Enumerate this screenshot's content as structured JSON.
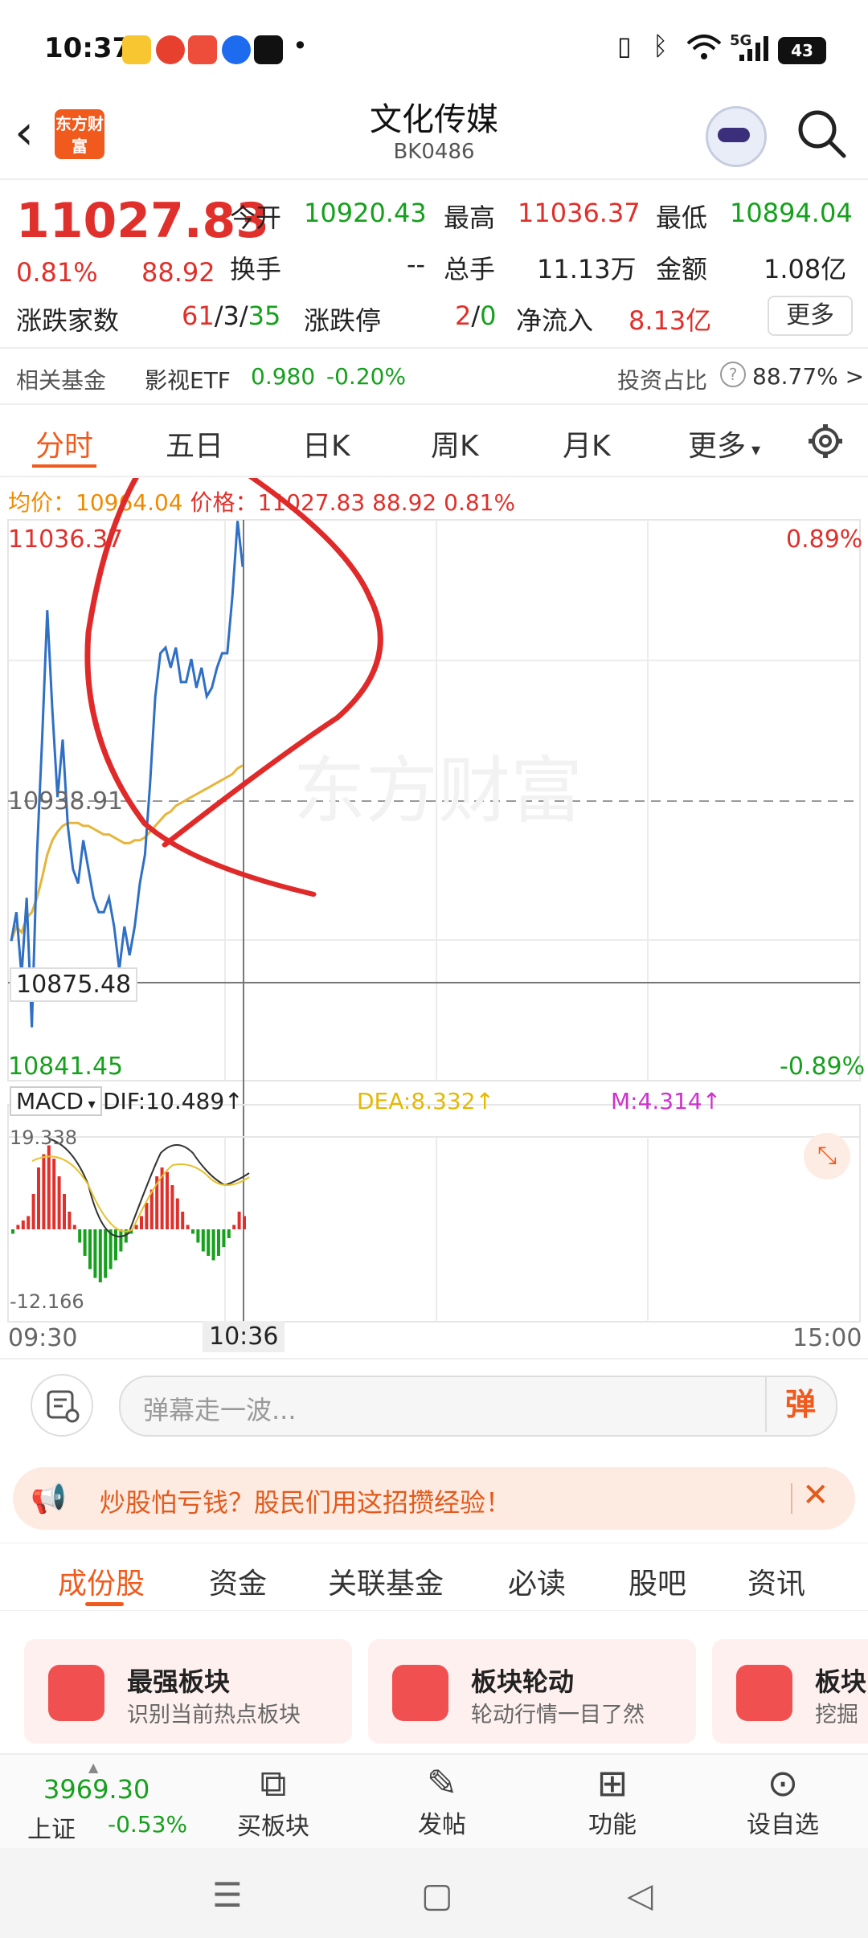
{
  "status": {
    "time": "10:37",
    "battery": "43",
    "network": "5G"
  },
  "header": {
    "title": "文化传媒",
    "code": "BK0486",
    "logo_text": "东方财富"
  },
  "quote": {
    "price": "11027.83",
    "change_pct": "0.81%",
    "change": "88.92",
    "open_label": "今开",
    "open": "10920.43",
    "high_label": "最高",
    "high": "11036.37",
    "low_label": "最低",
    "low": "10894.04",
    "turnover_label": "换手",
    "turnover": "--",
    "volume_label": "总手",
    "volume": "11.13万",
    "amount_label": "金额",
    "amount": "1.08亿",
    "updown_label": "涨跌家数",
    "up": "61",
    "flat": "3",
    "down": "35",
    "limit_label": "涨跌停",
    "limit_up": "2",
    "limit_down": "0",
    "inflow_label": "净流入",
    "inflow": "8.13亿",
    "more_label": "更多"
  },
  "fund": {
    "label": "相关基金",
    "name": "影视ETF",
    "price": "0.980",
    "pct": "-0.20%",
    "ratio_label": "投资占比",
    "ratio": "88.77% >"
  },
  "tabs": [
    "分时",
    "五日",
    "日K",
    "周K",
    "月K",
    "更多"
  ],
  "chart_header": {
    "avg_label": "均价：",
    "avg": "10964.04",
    "price_label": "价格：",
    "price": "11027.83",
    "change": "88.92",
    "pct": "0.81%"
  },
  "chart_data": {
    "type": "line",
    "y_range": [
      10841.45,
      11036.37
    ],
    "labels": {
      "top": "11036.37",
      "top_pct": "0.89%",
      "mid": "10938.91",
      "crosshair": "10875.48",
      "bottom": "10841.45",
      "bottom_pct": "-0.89%"
    },
    "x_ticks": [
      "09:30",
      "10:36",
      "15:00"
    ],
    "watermark": "东方财富",
    "price_series": [
      10890,
      10900,
      10878,
      10905,
      10860,
      10920,
      10960,
      11005,
      10970,
      10940,
      10960,
      10930,
      10915,
      10910,
      10925,
      10915,
      10905,
      10900,
      10900,
      10905,
      10895,
      10880,
      10895,
      10885,
      10895,
      10910,
      10920,
      10945,
      10975,
      10990,
      10992,
      10985,
      10992,
      10980,
      10980,
      10988,
      10978,
      10985,
      10975,
      10978,
      10985,
      10990,
      10990,
      11010,
      11036,
      11020
    ],
    "avg_series": [
      10890,
      10895,
      10893,
      10898,
      10900,
      10905,
      10912,
      10920,
      10925,
      10928,
      10930,
      10931,
      10931,
      10931,
      10930,
      10930,
      10929,
      10928,
      10927,
      10927,
      10926,
      10925,
      10924,
      10924,
      10925,
      10925,
      10926,
      10928,
      10930,
      10932,
      10934,
      10935,
      10937,
      10938,
      10939,
      10940,
      10941,
      10942,
      10943,
      10944,
      10945,
      10946,
      10947,
      10948,
      10950,
      10951
    ],
    "macd": {
      "label": "MACD",
      "dif_label": "DIF:10.489↑",
      "dea_label": "DEA:8.332↑",
      "m_label": "M:4.314↑",
      "y_top": "19.338",
      "y_bottom": "-12.166",
      "bars": [
        -1,
        1,
        2,
        3,
        8,
        14,
        17,
        19,
        16,
        12,
        8,
        4,
        1,
        -3,
        -6,
        -9,
        -11,
        -12,
        -11,
        -9,
        -7,
        -5,
        -3,
        -1,
        1,
        3,
        6,
        9,
        12,
        14,
        13,
        10,
        7,
        4,
        1,
        -1,
        -3,
        -5,
        -6,
        -7,
        -6,
        -4,
        -2,
        1,
        4,
        3
      ]
    }
  },
  "danmaku": {
    "placeholder": "弹幕走一波...",
    "button": "弹"
  },
  "ad": {
    "text": "炒股怕亏钱？股民们用这招攒经验！"
  },
  "lower_tabs": [
    "成份股",
    "资金",
    "关联基金",
    "必读",
    "股吧",
    "资讯"
  ],
  "cards": [
    {
      "title": "最强板块",
      "sub": "识别当前热点板块"
    },
    {
      "title": "板块轮动",
      "sub": "轮动行情一目了然"
    },
    {
      "title": "板块",
      "sub": "挖掘"
    }
  ],
  "bottom_nav": {
    "index_value": "3969.30",
    "index_name": "上证",
    "index_pct": "-0.53%",
    "items": [
      "买板块",
      "发帖",
      "功能",
      "设自选"
    ]
  }
}
